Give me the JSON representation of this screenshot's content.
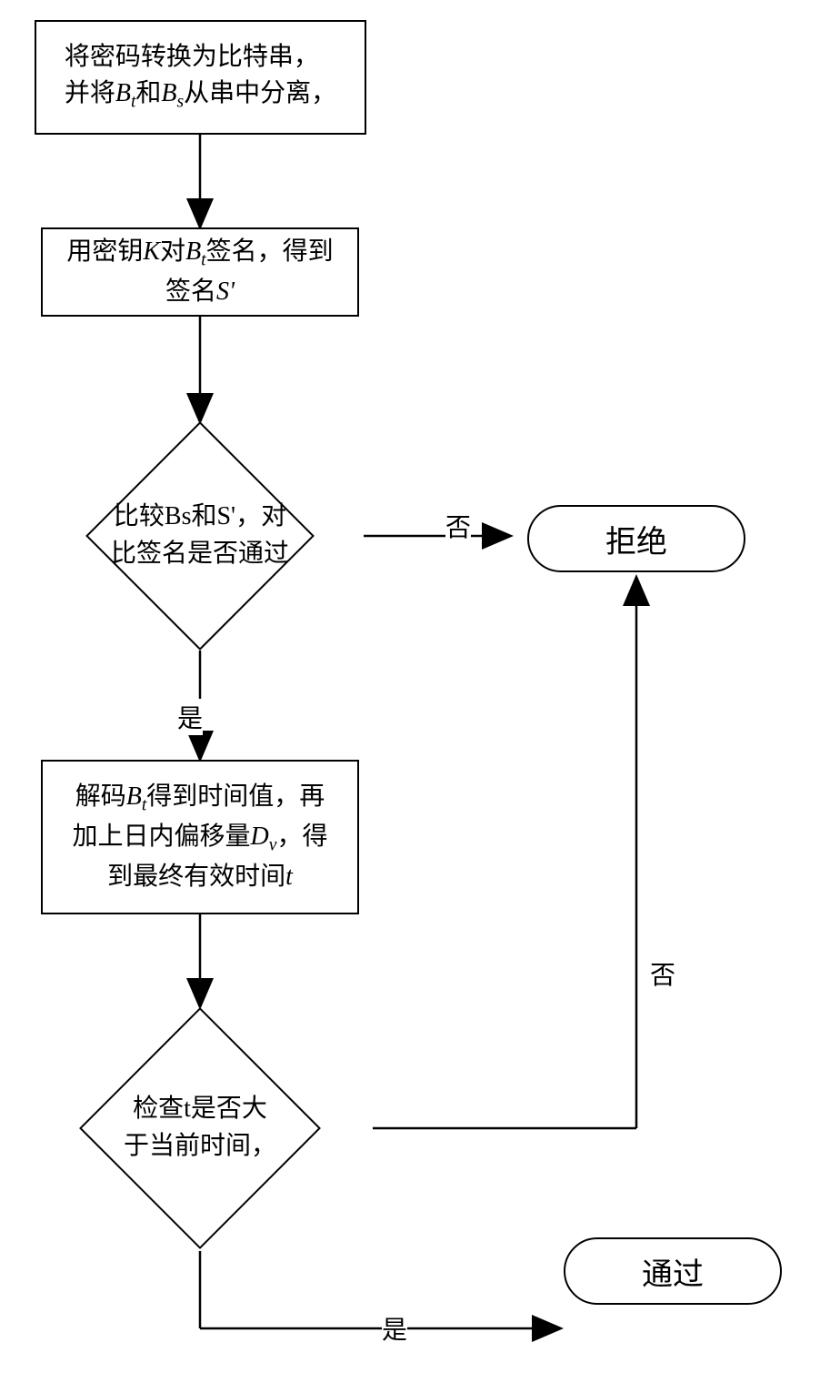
{
  "nodes": {
    "step1_line1": "将密码转换为比特串，",
    "step1_line2_prefix": "并将",
    "step1_bt": "B",
    "step1_bt_sub": "t",
    "step1_and": "和",
    "step1_bs": "B",
    "step1_bs_sub": "s",
    "step1_line2_suffix": "从串中分离，",
    "step2_prefix": "用密钥",
    "step2_K": "K",
    "step2_mid": "对",
    "step2_bt": "B",
    "step2_bt_sub": "t",
    "step2_after_bt": "签名，得到",
    "step2_line2_prefix": "签名",
    "step2_S": "S'",
    "decision1_line1": "比较Bs和S'，对",
    "decision1_line2": "比签名是否通过",
    "step3_prefix": "解码",
    "step3_bt": "B",
    "step3_bt_sub": "t",
    "step3_after_bt": "得到时间值，再",
    "step3_line2_prefix": "加上日内偏移量",
    "step3_Dv": "D",
    "step3_Dv_sub": "v",
    "step3_line2_suffix": "，得",
    "step3_line3_prefix": "到最终有效时间",
    "step3_t": "t",
    "decision2_line1": "检查t是否大",
    "decision2_line2": "于当前时间，",
    "reject": "拒绝",
    "pass": "通过"
  },
  "labels": {
    "no": "否",
    "yes": "是"
  }
}
